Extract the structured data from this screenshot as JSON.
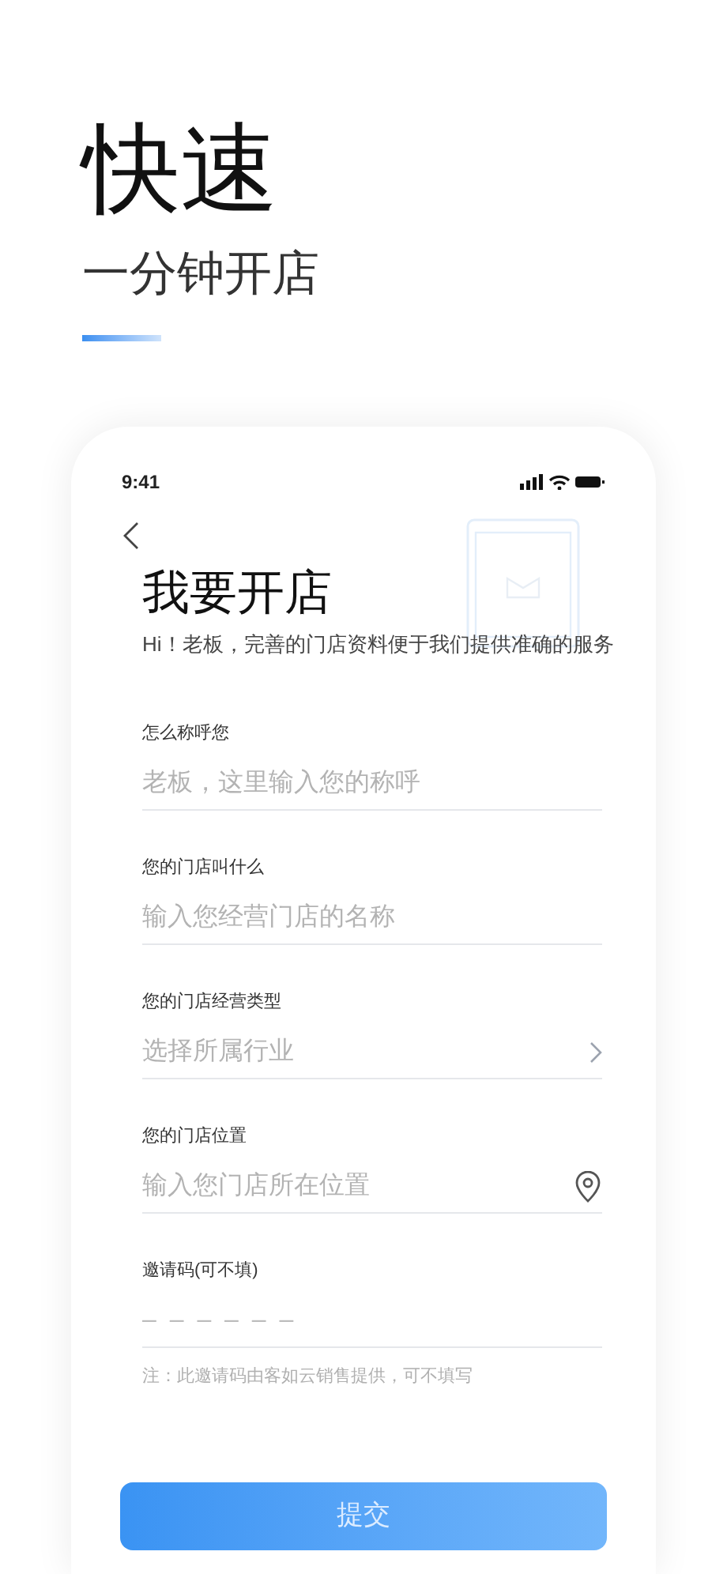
{
  "hero": {
    "title": "快速",
    "subtitle": "一分钟开店"
  },
  "phone": {
    "status_bar": {
      "time": "9:41"
    },
    "title": "我要开店",
    "intro": "Hi！老板，完善的门店资料便于我们提供准确的服务",
    "fields": [
      {
        "kind": "text",
        "label": "怎么称呼您",
        "placeholder": "老板，这里输入您的称呼"
      },
      {
        "kind": "text",
        "label": "您的门店叫什么",
        "placeholder": "输入您经营门店的名称"
      },
      {
        "kind": "select",
        "label": "您的门店经营类型",
        "placeholder": "选择所属行业"
      },
      {
        "kind": "location",
        "label": "您的门店位置",
        "placeholder": "输入您门店所在位置"
      },
      {
        "kind": "code",
        "label": "邀请码(可不填)",
        "placeholder": "– – – – – –"
      }
    ],
    "note": "注：此邀请码由客如云销售提供，可不填写",
    "submit": "提交"
  }
}
